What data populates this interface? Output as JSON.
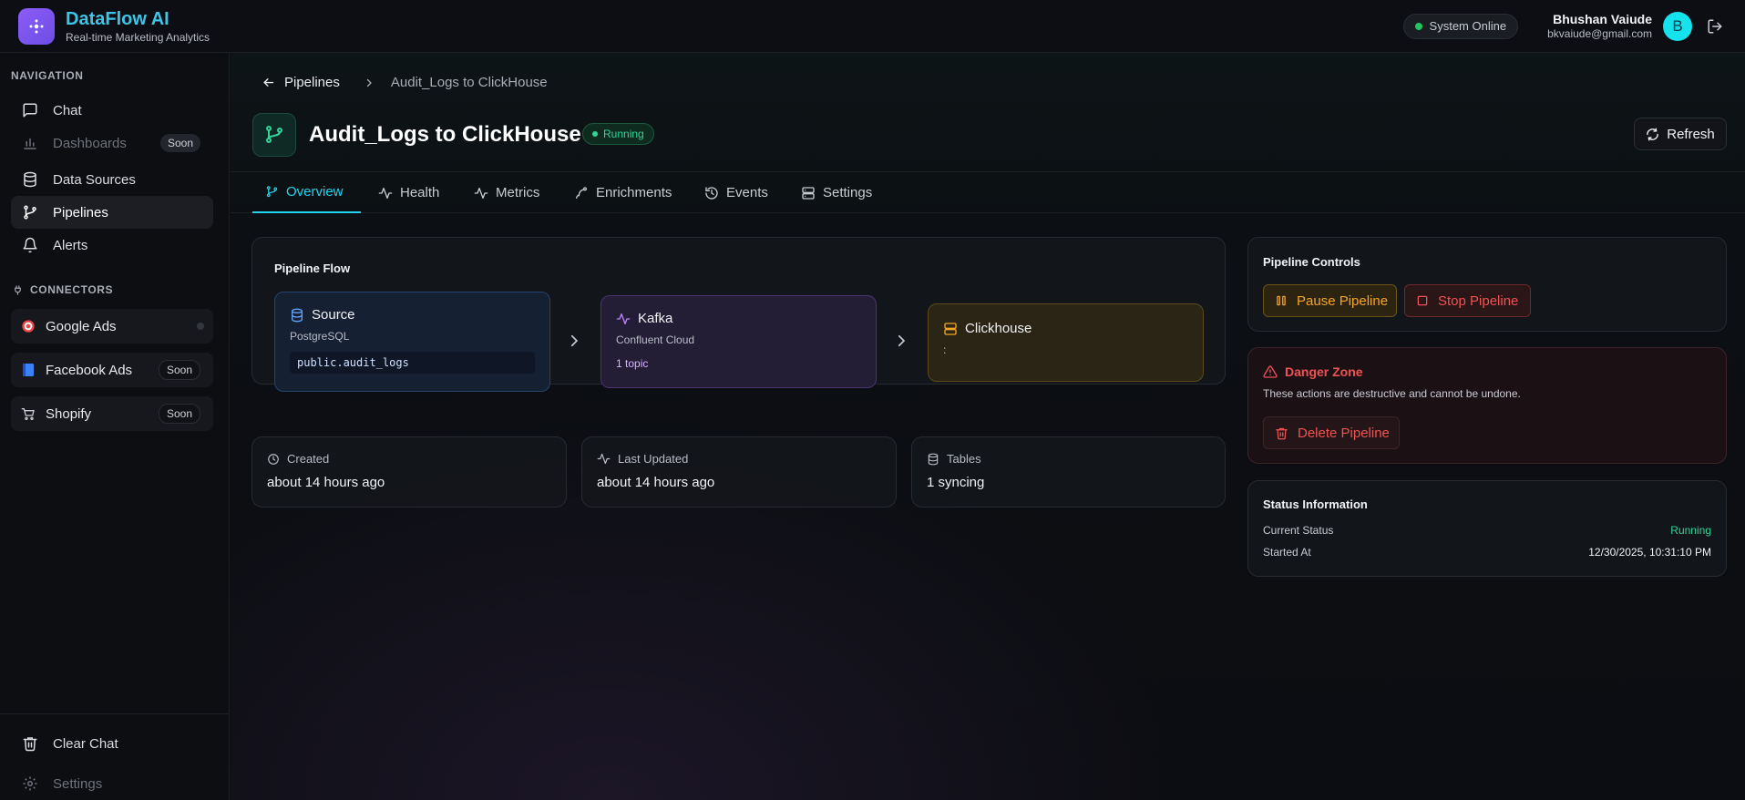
{
  "app": {
    "title": "DataFlow AI",
    "subtitle": "Real-time Marketing Analytics",
    "system_status": "System Online",
    "user_name": "Bhushan Vaiude",
    "user_email": "bkvaiude@gmail.com",
    "avatar_initial": "B"
  },
  "sidebar": {
    "nav_label": "NAVIGATION",
    "nav": [
      {
        "label": "Chat"
      },
      {
        "label": "Dashboards",
        "badge": "Soon"
      },
      {
        "label": "Data Sources"
      },
      {
        "label": "Pipelines"
      },
      {
        "label": "Alerts"
      }
    ],
    "connectors_label": "CONNECTORS",
    "connectors": [
      {
        "label": "Google Ads"
      },
      {
        "label": "Facebook Ads",
        "badge": "Soon"
      },
      {
        "label": "Shopify",
        "badge": "Soon"
      }
    ],
    "bottom": [
      {
        "label": "Clear Chat"
      },
      {
        "label": "Settings"
      }
    ]
  },
  "breadcrumb": {
    "back": "Pipelines",
    "current": "Audit_Logs to ClickHouse"
  },
  "pipeline": {
    "title": "Audit_Logs to ClickHouse",
    "status_badge": "Running",
    "refresh_label": "Refresh"
  },
  "tabs": [
    {
      "label": "Overview"
    },
    {
      "label": "Health"
    },
    {
      "label": "Metrics"
    },
    {
      "label": "Enrichments"
    },
    {
      "label": "Events"
    },
    {
      "label": "Settings"
    }
  ],
  "flow": {
    "title": "Pipeline Flow",
    "source": {
      "title": "Source",
      "type": "PostgreSQL",
      "table": "public.audit_logs"
    },
    "kafka": {
      "title": "Kafka",
      "type": "Confluent Cloud",
      "topics": "1 topic"
    },
    "sink": {
      "title": "Clickhouse",
      "detail": ":"
    }
  },
  "stats": {
    "created_label": "Created",
    "created_value": "about 14 hours ago",
    "updated_label": "Last Updated",
    "updated_value": "about 14 hours ago",
    "tables_label": "Tables",
    "tables_value": "1 syncing"
  },
  "controls": {
    "title": "Pipeline Controls",
    "pause": "Pause Pipeline",
    "stop": "Stop Pipeline"
  },
  "danger": {
    "title": "Danger Zone",
    "desc": "These actions are destructive and cannot be undone.",
    "delete": "Delete Pipeline"
  },
  "status_info": {
    "title": "Status Information",
    "current_label": "Current Status",
    "current_value": "Running",
    "started_label": "Started At",
    "started_value": "12/30/2025, 10:31:10 PM"
  },
  "colors": {
    "accent": "#22d3ee",
    "success": "#34d399",
    "warning": "#f5a524",
    "danger": "#f05252",
    "kafka": "#c084fc"
  }
}
